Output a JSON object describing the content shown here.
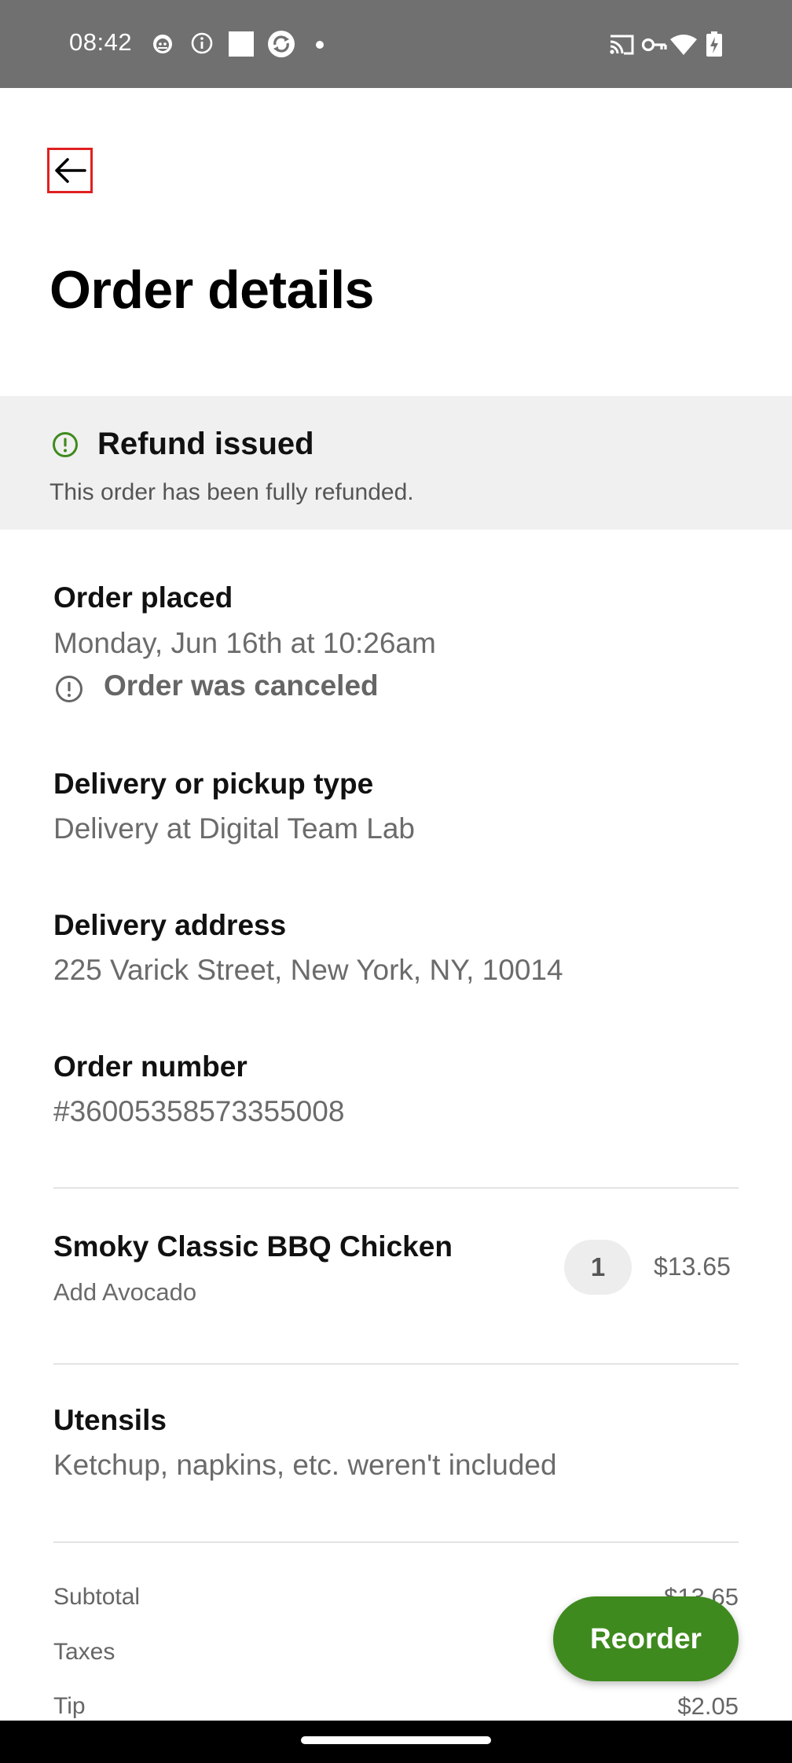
{
  "status_bar": {
    "time": "08:42",
    "left_icons": [
      "cat-face-icon",
      "info-circle-icon",
      "white-square-icon",
      "sync-badge-icon",
      "dot-icon"
    ],
    "right_icons": [
      "cast-icon",
      "vpn-key-icon",
      "wifi-icon",
      "battery-charging-icon"
    ]
  },
  "header": {
    "back_icon": "arrow-left-icon",
    "title": "Order details"
  },
  "refund": {
    "icon": "exclamation-circle-icon",
    "title": "Refund issued",
    "subtitle": "This order has been fully refunded.",
    "accent": "#3f8a1e"
  },
  "order_placed": {
    "label": "Order placed",
    "value": "Monday, Jun 16th at 10:26am",
    "status_icon": "exclamation-circle-icon",
    "status": "Order was canceled"
  },
  "delivery_type": {
    "label": "Delivery or pickup type",
    "value": "Delivery at Digital Team Lab"
  },
  "delivery_address": {
    "label": "Delivery address",
    "value": "225 Varick Street, New York, NY, 10014"
  },
  "order_number": {
    "label": "Order number",
    "value": "#36005358573355008"
  },
  "items": [
    {
      "name": "Smoky Classic BBQ Chicken",
      "modifier": "Add Avocado",
      "quantity": "1",
      "price": "$13.65"
    }
  ],
  "utensils": {
    "label": "Utensils",
    "value": "Ketchup, napkins, etc. weren't included"
  },
  "summary": {
    "subtotal_label": "Subtotal",
    "subtotal_value": "$13.65",
    "taxes_label": "Taxes",
    "tip_label": "Tip",
    "tip_value": "$2.05"
  },
  "reorder_button": {
    "label": "Reorder",
    "color": "#3f8a1e"
  }
}
